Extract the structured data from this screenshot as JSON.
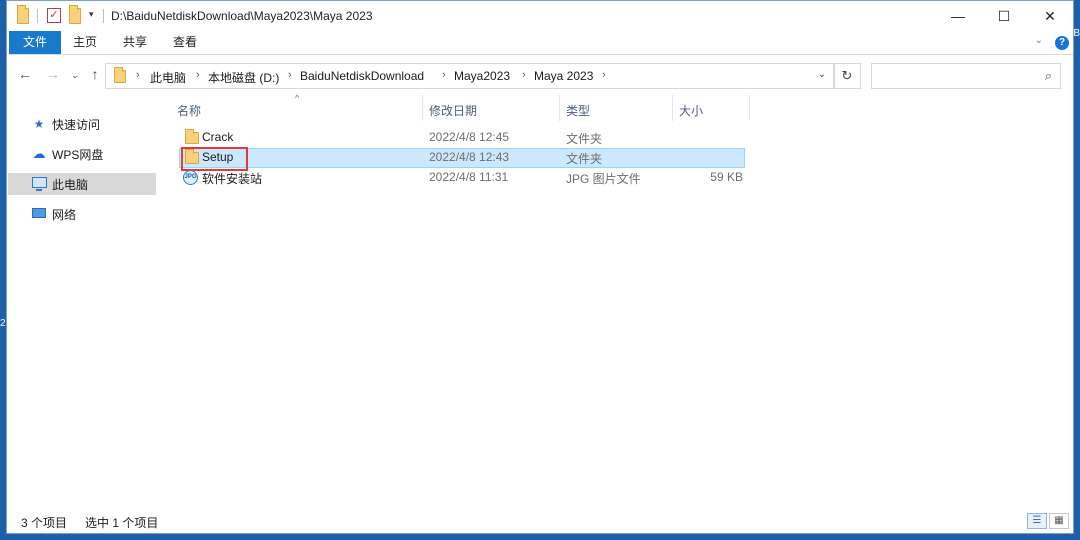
{
  "window": {
    "path_title": "D:\\BaiduNetdiskDownload\\Maya2023\\Maya 2023",
    "controls": {
      "minimize": "—",
      "maximize": "☐",
      "close": "✕"
    }
  },
  "ribbon": {
    "tabs": [
      "文件",
      "主页",
      "共享",
      "查看"
    ],
    "help": "?"
  },
  "address": {
    "crumbs": [
      "此电脑",
      "本地磁盘 (D:)",
      "BaiduNetdiskDownload",
      "Maya2023",
      "Maya 2023"
    ],
    "search_placeholder": ""
  },
  "navpane": {
    "items": [
      {
        "label": "快速访问",
        "icon": "star-icon"
      },
      {
        "label": "WPS网盘",
        "icon": "cloud-icon"
      },
      {
        "label": "此电脑",
        "icon": "computer-icon",
        "selected": true
      },
      {
        "label": "网络",
        "icon": "network-icon"
      }
    ]
  },
  "filelist": {
    "columns": [
      "名称",
      "修改日期",
      "类型",
      "大小"
    ],
    "rows": [
      {
        "name": "Crack",
        "date": "2022/4/8 12:45",
        "type": "文件夹",
        "size": "",
        "icon": "folder-icon"
      },
      {
        "name": "Setup",
        "date": "2022/4/8 12:43",
        "type": "文件夹",
        "size": "",
        "icon": "folder-icon",
        "selected": true,
        "highlighted": true
      },
      {
        "name": "软件安装站",
        "date": "2022/4/8 11:31",
        "type": "JPG 图片文件",
        "size": "59 KB",
        "icon": "jpg-file-icon"
      }
    ]
  },
  "status": {
    "item_count": "3 个项目",
    "selection": "选中 1 个项目"
  },
  "colors": {
    "accent": "#1979ca",
    "selection_bg": "#cce8ff",
    "highlight_box": "#e23a3a"
  }
}
